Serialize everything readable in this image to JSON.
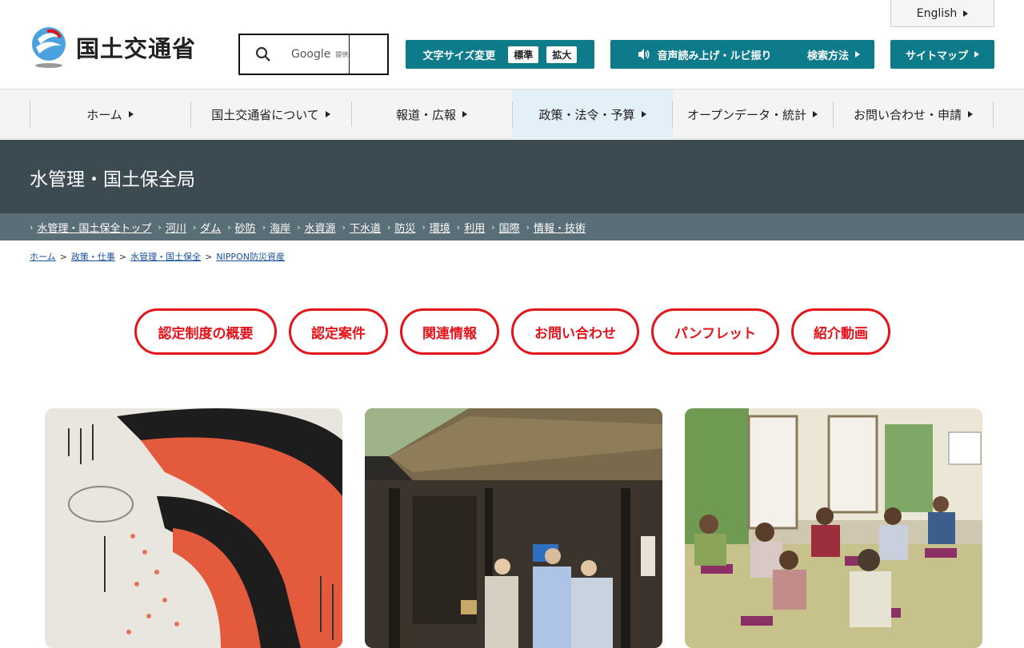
{
  "header": {
    "logo_text": "国土交通省",
    "search": {
      "provider_label": "Google",
      "provided_label": "提供"
    },
    "english_label": "English",
    "font_size": {
      "label": "文字サイズ変更",
      "standard": "標準",
      "large": "拡大"
    },
    "voice_label": "音声読み上げ・ルビ振り",
    "search_method_label": "検索方法",
    "sitemap_label": "サイトマップ"
  },
  "gnav": {
    "items": [
      {
        "label": "ホーム"
      },
      {
        "label": "国土交通省について"
      },
      {
        "label": "報道・広報"
      },
      {
        "label": "政策・法令・予算",
        "active": true
      },
      {
        "label": "オープンデータ・統計"
      },
      {
        "label": "お問い合わせ・申請"
      }
    ]
  },
  "bureau": {
    "title": "水管理・国土保全局",
    "subnav": [
      "水管理・国土保全トップ",
      "河川",
      "ダム",
      "砂防",
      "海岸",
      "水資源",
      "下水道",
      "防災",
      "環境",
      "利用",
      "国際",
      "情報・技術"
    ]
  },
  "breadcrumb": [
    "ホーム",
    "政策・仕事",
    "水管理・国土保全",
    "NIPPON防災資産"
  ],
  "pills": [
    "認定制度の概要",
    "認定案件",
    "関連情報",
    "お問い合わせ",
    "パンフレット",
    "紹介動画"
  ],
  "colors": {
    "teal": "#0e7b8a",
    "red": "#e5141b",
    "bureau_bg": "#3c4b52",
    "subnav_bg": "#5a6e78"
  }
}
